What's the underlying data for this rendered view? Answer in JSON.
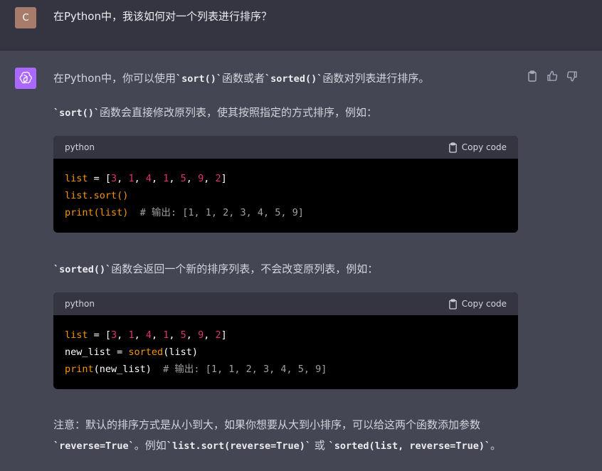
{
  "user": {
    "avatar_letter": "C",
    "avatar_color": "#a87c6b",
    "message": "在Python中，我该如何对一个列表进行排序？"
  },
  "assistant": {
    "avatar_color": "#ab68ff",
    "intro": {
      "pre": "在Python中，你可以使用",
      "code1": "`sort()`",
      "mid": "函数或者",
      "code2": "`sorted()`",
      "post": "函数对列表进行排序。"
    },
    "sort_desc": {
      "code": "`sort()`",
      "text": "函数会直接修改原列表，使其按照指定的方式排序，例如："
    },
    "block1": {
      "lang": "python",
      "copy_label": "Copy code",
      "lines": [
        [
          {
            "t": "list",
            "c": "fn"
          },
          {
            "t": " = [",
            "c": "pu"
          },
          {
            "t": "3",
            "c": "num"
          },
          {
            "t": ", ",
            "c": "pu"
          },
          {
            "t": "1",
            "c": "num"
          },
          {
            "t": ", ",
            "c": "pu"
          },
          {
            "t": "4",
            "c": "num"
          },
          {
            "t": ", ",
            "c": "pu"
          },
          {
            "t": "1",
            "c": "num"
          },
          {
            "t": ", ",
            "c": "pu"
          },
          {
            "t": "5",
            "c": "num"
          },
          {
            "t": ", ",
            "c": "pu"
          },
          {
            "t": "9",
            "c": "num"
          },
          {
            "t": ", ",
            "c": "pu"
          },
          {
            "t": "2",
            "c": "num"
          },
          {
            "t": "]",
            "c": "pu"
          }
        ],
        [
          {
            "t": "list.sort()",
            "c": "fn"
          }
        ],
        [
          {
            "t": "print",
            "c": "fn"
          },
          {
            "t": "(list)",
            "c": "fn"
          },
          {
            "t": "  # 输出: [1, 1, 2, 3, 4, 5, 9]",
            "c": "cm"
          }
        ]
      ]
    },
    "sorted_desc": {
      "code": "`sorted()`",
      "text": "函数会返回一个新的排序列表，不会改变原列表，例如："
    },
    "block2": {
      "lang": "python",
      "copy_label": "Copy code",
      "lines": [
        [
          {
            "t": "list",
            "c": "fn"
          },
          {
            "t": " = [",
            "c": "pu"
          },
          {
            "t": "3",
            "c": "num"
          },
          {
            "t": ", ",
            "c": "pu"
          },
          {
            "t": "1",
            "c": "num"
          },
          {
            "t": ", ",
            "c": "pu"
          },
          {
            "t": "4",
            "c": "num"
          },
          {
            "t": ", ",
            "c": "pu"
          },
          {
            "t": "1",
            "c": "num"
          },
          {
            "t": ", ",
            "c": "pu"
          },
          {
            "t": "5",
            "c": "num"
          },
          {
            "t": ", ",
            "c": "pu"
          },
          {
            "t": "9",
            "c": "num"
          },
          {
            "t": ", ",
            "c": "pu"
          },
          {
            "t": "2",
            "c": "num"
          },
          {
            "t": "]",
            "c": "pu"
          }
        ],
        [
          {
            "t": "new_list = ",
            "c": "id"
          },
          {
            "t": "sorted",
            "c": "fn"
          },
          {
            "t": "(list)",
            "c": "pu"
          }
        ],
        [
          {
            "t": "print",
            "c": "fn"
          },
          {
            "t": "(new_list)",
            "c": "pu"
          },
          {
            "t": "  # 输出: [1, 1, 2, 3, 4, 5, 9]",
            "c": "cm"
          }
        ]
      ]
    },
    "note": {
      "line1": "注意：默认的排序方式是从小到大，如果你想要从大到小排序，可以给这两个函数添加参数",
      "code_a": "`reverse=True`",
      "mid": "。例如",
      "code_b": "`list.sort(reverse=True)`",
      "or": " 或 ",
      "code_c": "`sorted(list, reverse=True)`",
      "end": "。"
    }
  },
  "actions": {
    "copy_icon": "clipboard-icon",
    "thumbs_up_icon": "thumbs-up-icon",
    "thumbs_down_icon": "thumbs-down-icon"
  }
}
